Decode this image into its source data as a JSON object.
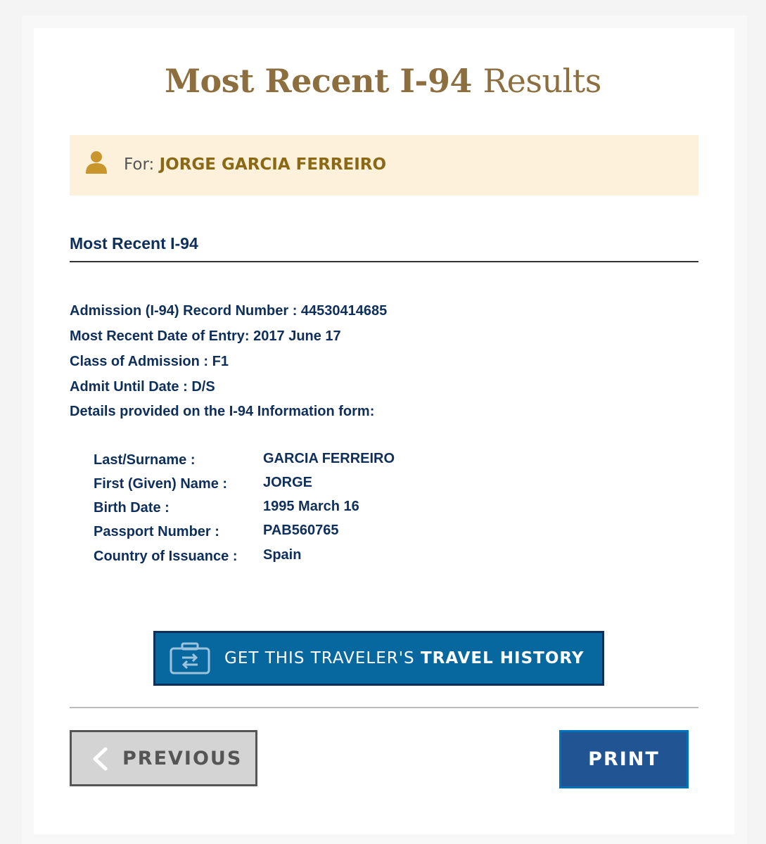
{
  "header": {
    "title_bold": "Most Recent I-94",
    "title_light": "Results"
  },
  "traveler": {
    "for_label": "For:",
    "name": "JORGE GARCIA FERREIRO",
    "icon": "person-icon"
  },
  "record": {
    "section_title": "Most Recent I-94",
    "lines": [
      "Admission (I-94) Record Number : 44530414685",
      "Most Recent Date of Entry: 2017 June 17",
      "Class of Admission : F1",
      "Admit Until Date : D/S",
      "Details provided on the I-94 Information form:"
    ],
    "details": [
      {
        "label": "Last/Surname :",
        "value": "GARCIA FERREIRO"
      },
      {
        "label": "First (Given) Name :",
        "value": "JORGE"
      },
      {
        "label": "Birth Date :",
        "value": "1995 March 16"
      },
      {
        "label": "Passport Number :",
        "value": "PAB560765"
      },
      {
        "label": "Country of Issuance :",
        "value": "Spain"
      }
    ]
  },
  "travel_history_button": {
    "prefix": "GET THIS TRAVELER'S",
    "emphasis": "TRAVEL HISTORY",
    "icon": "suitcase-transfer-icon"
  },
  "nav": {
    "previous_label": "PREVIOUS",
    "print_label": "PRINT"
  },
  "colors": {
    "title": "#8d6e3f",
    "for_bar_bg": "#fdf1dc",
    "text_navy": "#0e2f5b",
    "travel_button": "#07689f",
    "print_button": "#205493"
  }
}
